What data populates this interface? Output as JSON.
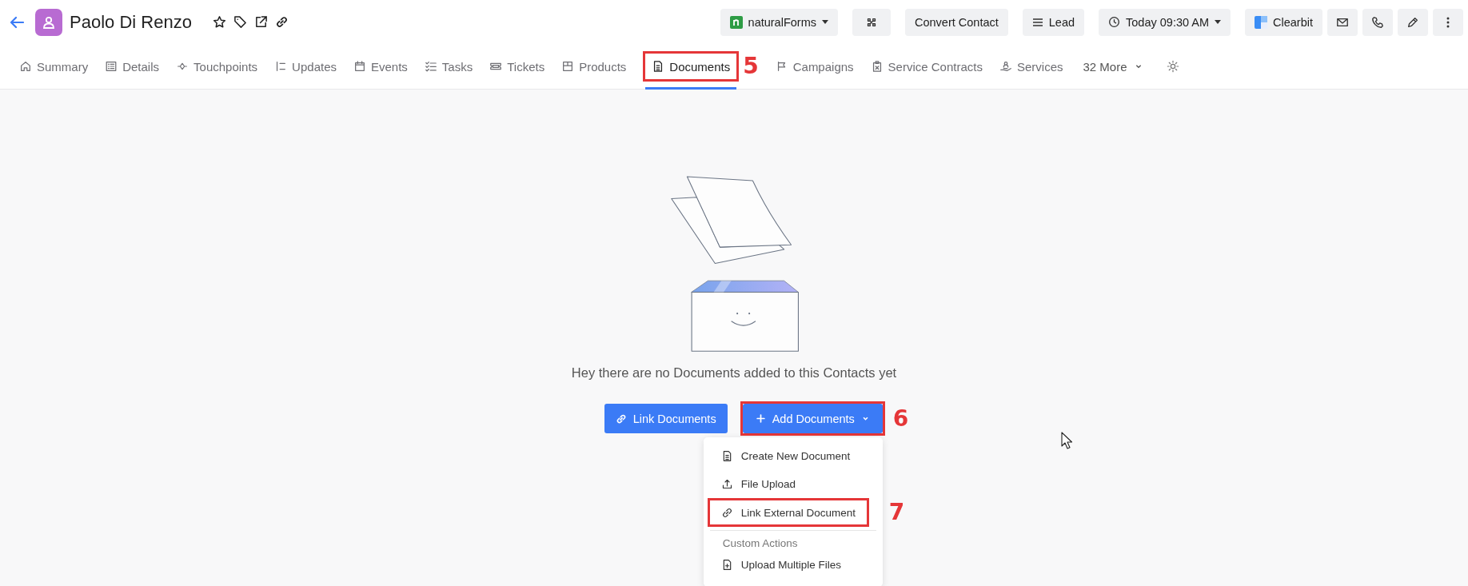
{
  "header": {
    "contact_name": "Paolo Di Renzo",
    "actions": [
      {
        "kind": "app-dropdown",
        "label": "naturalForms"
      },
      {
        "kind": "network"
      },
      {
        "kind": "text",
        "label": "Convert Contact"
      },
      {
        "kind": "menu",
        "label": "Lead"
      },
      {
        "kind": "clock-dropdown",
        "label": "Today 09:30 AM"
      },
      {
        "kind": "brand",
        "label": "Clearbit"
      },
      {
        "kind": "mail"
      },
      {
        "kind": "phone"
      },
      {
        "kind": "edit"
      },
      {
        "kind": "more"
      }
    ]
  },
  "tabs": [
    {
      "label": "Summary",
      "selected": false
    },
    {
      "label": "Details",
      "selected": false
    },
    {
      "label": "Touchpoints",
      "selected": false
    },
    {
      "label": "Updates",
      "selected": false
    },
    {
      "label": "Events",
      "selected": false
    },
    {
      "label": "Tasks",
      "selected": false
    },
    {
      "label": "Tickets",
      "selected": false
    },
    {
      "label": "Products",
      "selected": false
    },
    {
      "label": "Documents",
      "selected": true,
      "callout": "5"
    },
    {
      "label": "Campaigns",
      "selected": false
    },
    {
      "label": "Service Contracts",
      "selected": false
    },
    {
      "label": "Services",
      "selected": false
    }
  ],
  "more_tabs": "32 More",
  "empty_state": {
    "message": "Hey there are no Documents added to this Contacts yet",
    "link_button": "Link Documents",
    "add_button": {
      "label": "Add Documents",
      "callout": "6"
    },
    "menu": [
      {
        "kind": "item",
        "label": "Create New Document"
      },
      {
        "kind": "item",
        "label": "File Upload"
      },
      {
        "kind": "item",
        "label": "Link External Document",
        "callout": "7"
      },
      {
        "kind": "heading",
        "label": "Custom Actions"
      },
      {
        "kind": "item",
        "label": "Upload Multiple Files"
      }
    ]
  }
}
